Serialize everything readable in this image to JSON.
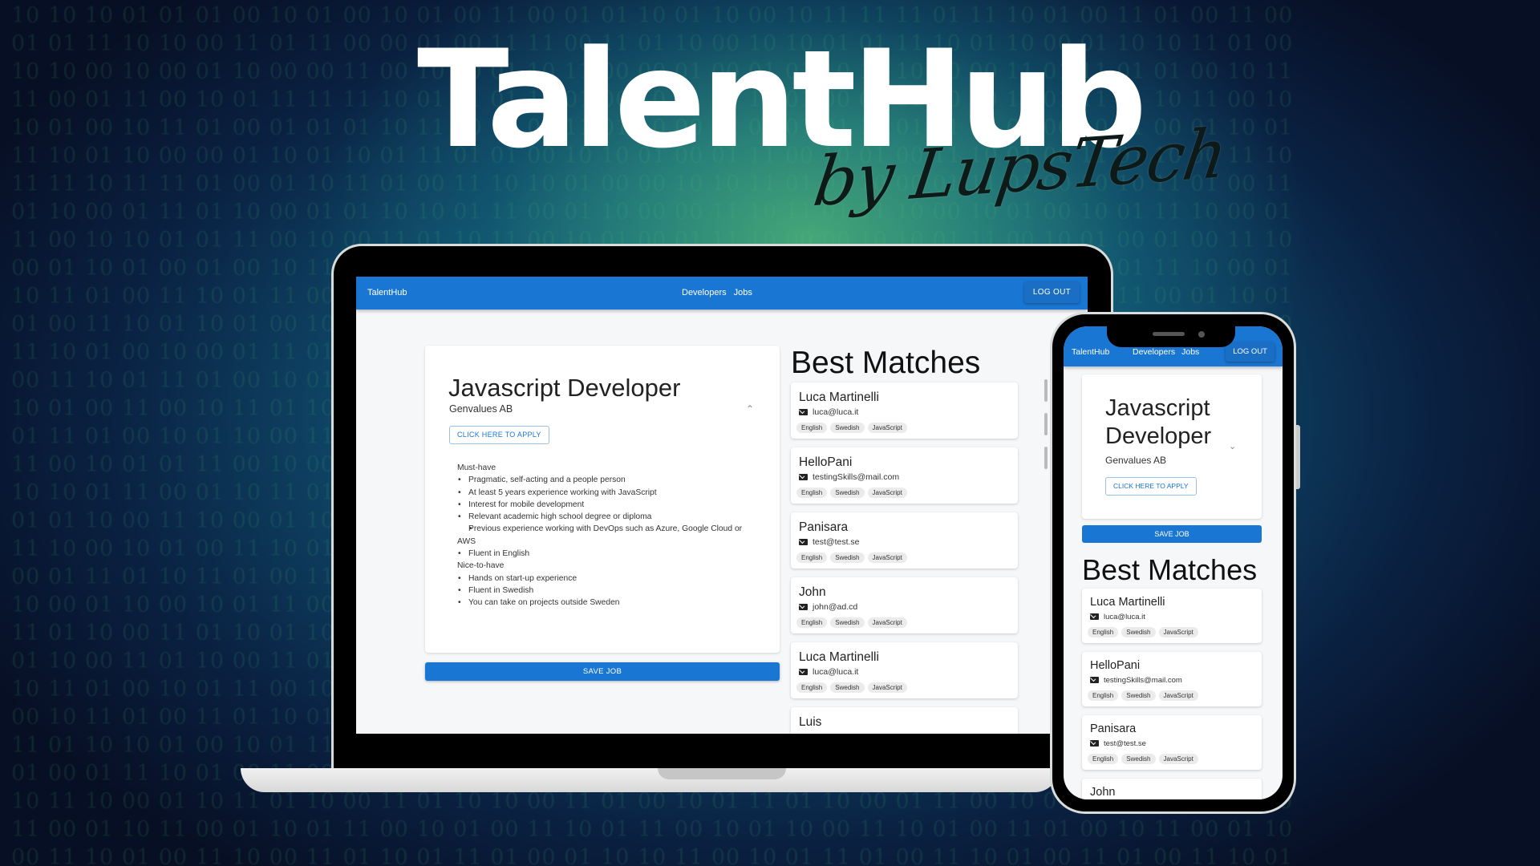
{
  "hero": {
    "title": "TalentHub",
    "subtitle": "by LupsTech"
  },
  "background": {
    "binary_rows": [
      "10 10 10 01 01 01 00 10 01 00 10 01 00 11 00 01 01 10 01 10 00 10 11 11 11 01 11 10 01 00 11 01 00 11 00",
      "01 01 11 10 10 00 11 01 11 00 00 01 00 11 11 00 11 01 10 00 10 10 01 01 11 10 01 10 00 01 10 10 11 01 00",
      "10 10 00 10 00 01 10 00 00 11 00 10 00 01 10 11 00 00 01 00 01 01 10 11 10 10 00 11 01 11 01 01 00 10 11",
      "11 00 01 11 00 10 01 11 11 11 10 01 11 01 10 01 00 10 11 01 10 01 00 01 11 10 00 10 01 11 11 10 11 00 10",
      "10 01 00 10 11 01 00 01 01 01 10 11 00 10 01 11 01 10 00 11 00 01 01 10 01 11 11 01 00 10 11 00 01 10 01",
      "11 10 01 10 00 00 01 10 01 10 01 11 01 01 00 10 10 01 00 01 11 00 10 01 00 11 10 01 00 11 01 10 00 11 10",
      "11 11 10 11 11 01 00 01 10 11 01 00 11 10 10 01 00 00 10 10 11 01 01 10 00 01 11 01 00 10 10 11 01 00 11",
      "01 10 00 01 11 01 10 00 01 01 10 10 01 11 00 01 10 00 00 11 10 11 01 11 10 00 10 01 00 10 01 11 10 00 01",
      "11 00 10 10 01 01 11 00 10 00 11 01 10 11 00 10 01 00 01 11 10 00 00 10 10 01 11 00 10 01 00 01 00 11 10",
      "00 01 10 01 00 01 00 10 11 01 10 11 01 00 01 10 10 11 11 00 01 00 10 01 00 11 01 10 00 10 01 11 10 00 01",
      "10 11 01 00 11 10 01 11 00 01 10 10 00 11 11 10 01 00 00 01 11 01 10 00 10 01 00 11 01 10 11 00 01 10 01",
      "01 00 11 10 01 10 01 00 10 11 00 01 00 10 01 11 10 11 01 00 00 10 01 11 10 00 01 10 11 01 00 01 10 11 00",
      "11 10 01 00 10 00 01 11 01 00 11 10 01 00 10 11 01 00 11 01 10 10 00 01 11 10 01 00 01 00 10 11 01 00 10",
      "00 11 10 01 11 01 00 10 01 10 00 11 10 01 00 10 11 01 00 11 01 00 10 11 00 01 10 11 01 10 00 01 11 10 01",
      "10 01 00 11 00 10 11 01 10 00 01 01 11 10 01 00 10 00 11 01 10 11 00 01 10 01 11 00 10 01 10 00 01 11 10",
      "01 11 01 00 10 01 10 00 11 01 10 00 01 11 10 01 00 11 01 00 01 10 11 00 01 10 00 11 01 10 01 11 00 10 01",
      "11 00 10 01 01 11 00 10 00 10 11 01 10 00 01 11 01 10 00 10 11 00 01 10 11 00 10 01 00 11 01 00 10 01 11",
      "10 10 01 11 00 01 10 11 01 00 10 01 00 11 10 00 01 11 10 01 00 10 11 00 01 11 01 00 10 01 11 10 00 01 10",
      "01 01 10 00 11 10 00 01 10 11 01 10 11 00 01 10 11 00 01 10 01 11 00 10 01 00 11 10 01 00 10 01 11 10 00",
      "11 10 00 10 01 00 11 10 01 00 11 01 00 10 11 01 10 01 11 00 10 01 10 11 00 10 01 00 11 10 01 10 00 11 01",
      "00 01 11 01 10 11 01 00 11 10 00 10 11 01 00 11 00 10 01 11 01 00 11 01 10 01 00 11 10 01 00 11 01 00 10",
      "10 00 01 10 00 10 01 11 00 01 10 11 01 10 10 00 11 01 00 10 11 10 01 00 11 10 01 10 00 11 01 00 10 11 01",
      "11 01 10 00 11 01 10 01 10 11 00 01 10 00 11 01 10 00 11 01 00 11 10 01 00 10 11 01 10 00 11 01 10 01 00",
      "01 10 00 11 01 10 00 11 01 00 10 11 01 10 01 00 11 01 10 01 11 00 10 11 01 00 10 01 11 01 00 10 01 11 10",
      "10 11 01 00 10 01 11 00 10 01 11 00 10 01 00 11 10 01 00 11 10 01 00 10 01 11 01 00 10 11 01 10 00 10 01",
      "00 10 11 01 00 11 01 10 01 10 00 11 01 10 11 00 01 10 11 00 01 10 11 01 10 00 11 10 01 00 10 11 01 00 11",
      "11 01 10 10 01 00 10 01 11 00 10 01 10 11 00 10 01 11 00 10 11 01 00 10 11 01 00 11 10 01 10 00 11 01 10",
      "01 00 01 11 10 01 00 11 00 11 01 10 00 01 11 01 10 00 11 01 00 10 01 11 00 10 11 01 00 10 01 11 10 00 01",
      "10 11 10 00 01 10 11 01 10 00 11 01 10 10 00 11 01 00 10 01 11 01 10 00 01 11 00 10 01 11 00 01 10 11 00",
      "11 00 01 10 11 00 01 10 01 11 00 10 01 00 11 10 01 11 00 10 01 10 00 11 10 01 00 11 01 00 10 11 00 01 10",
      "00 11 10 01 00 11 10 00 11 01 10 01 11 01 00 01 10 10 11 00 10 01 11 01 00 11 10 01 00 11 01 00 11 10 01"
    ]
  },
  "app": {
    "brand": "TalentHub",
    "nav_links": [
      "Developers",
      "Jobs"
    ],
    "logout_label": "LOG OUT",
    "job": {
      "title": "Javascript Developer",
      "company": "Genvalues AB",
      "apply_label": "CLICK HERE TO APPLY",
      "must_have_heading": "Must-have",
      "must_have": [
        "Pragmatic, self-acting and a people person",
        "At least 5 years experience working with JavaScript",
        "Interest for mobile development",
        "Relevant academic high school degree or diploma",
        "Previous experience working with DevOps such as Azure, Google Cloud or AWS",
        "Fluent in English"
      ],
      "nice_to_have_heading": "Nice-to-have",
      "nice_to_have": [
        "Hands on start-up experience",
        "Fluent in Swedish",
        "You can take on projects outside Sweden"
      ]
    },
    "save_job_label": "SAVE JOB",
    "matches_title": "Best Matches",
    "matches": [
      {
        "name": "Luca Martinelli",
        "email": "luca@luca.it",
        "skills": [
          "English",
          "Swedish",
          "JavaScript"
        ]
      },
      {
        "name": "HelloPani",
        "email": "testingSkills@mail.com",
        "skills": [
          "English",
          "Swedish",
          "JavaScript"
        ]
      },
      {
        "name": "Panisara",
        "email": "test@test.se",
        "skills": [
          "English",
          "Swedish",
          "JavaScript"
        ]
      },
      {
        "name": "John",
        "email": "john@ad.cd",
        "skills": [
          "English",
          "Swedish",
          "JavaScript"
        ]
      },
      {
        "name": "Luca Martinelli",
        "email": "luca@luca.it",
        "skills": [
          "English",
          "Swedish",
          "JavaScript"
        ]
      },
      {
        "name": "Luis",
        "email": "",
        "skills": []
      }
    ]
  },
  "colors": {
    "primary": "#1976d2",
    "page_bg": "#f6f7f9"
  }
}
